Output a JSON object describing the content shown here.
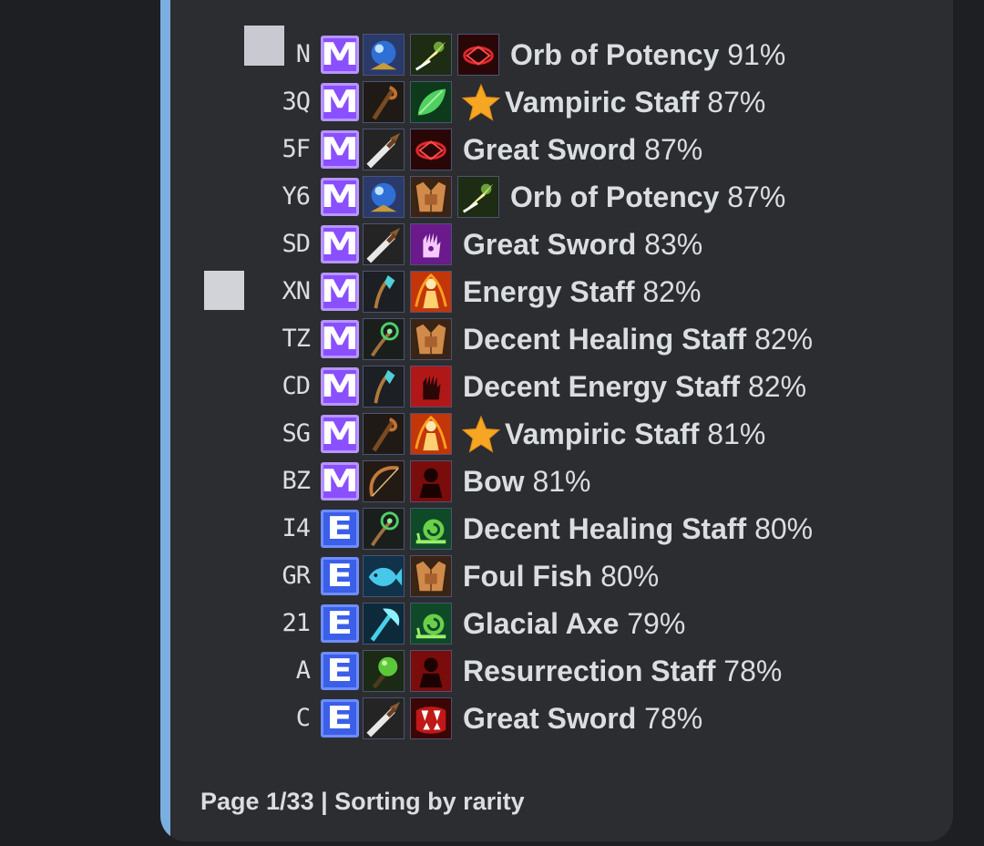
{
  "rows": [
    {
      "code": "N",
      "rarity": "M",
      "name": "Orb of Potency",
      "percent": "91%",
      "star": false,
      "icons": [
        "orb-icon",
        "dart-icon",
        "red-rune-icon"
      ]
    },
    {
      "code": "3Q",
      "rarity": "M",
      "name": "Vampiric Staff",
      "percent": "87%",
      "star": true,
      "icons": [
        "staff-icon",
        "leaf-icon"
      ]
    },
    {
      "code": "5F",
      "rarity": "M",
      "name": "Great Sword",
      "percent": "87%",
      "star": false,
      "icons": [
        "sword-icon",
        "red-rune-icon"
      ]
    },
    {
      "code": "Y6",
      "rarity": "M",
      "name": "Orb of Potency",
      "percent": "87%",
      "star": false,
      "icons": [
        "orb-icon",
        "torso-icon",
        "dart-icon"
      ]
    },
    {
      "code": "SD",
      "rarity": "M",
      "name": "Great Sword",
      "percent": "83%",
      "star": false,
      "icons": [
        "sword-icon",
        "purple-hand-icon"
      ]
    },
    {
      "code": "XN",
      "rarity": "M",
      "name": "Energy Staff",
      "percent": "82%",
      "star": false,
      "icons": [
        "crystal-staff-icon",
        "flame-figure-icon"
      ]
    },
    {
      "code": "TZ",
      "rarity": "M",
      "name": "Decent Healing Staff",
      "percent": "82%",
      "star": false,
      "icons": [
        "green-staff-icon",
        "torso-icon"
      ]
    },
    {
      "code": "CD",
      "rarity": "M",
      "name": "Decent Energy Staff",
      "percent": "82%",
      "star": false,
      "icons": [
        "crystal-staff-icon",
        "red-hand-icon"
      ]
    },
    {
      "code": "SG",
      "rarity": "M",
      "name": "Vampiric Staff",
      "percent": "81%",
      "star": true,
      "icons": [
        "staff-icon",
        "flame-figure-icon"
      ]
    },
    {
      "code": "BZ",
      "rarity": "M",
      "name": "Bow",
      "percent": "81%",
      "star": false,
      "icons": [
        "bow-icon",
        "dark-figure-icon"
      ]
    },
    {
      "code": "I4",
      "rarity": "E",
      "name": "Decent Healing Staff",
      "percent": "80%",
      "star": false,
      "icons": [
        "green-staff-icon",
        "snail-icon"
      ]
    },
    {
      "code": "GR",
      "rarity": "E",
      "name": "Foul Fish",
      "percent": "80%",
      "star": false,
      "icons": [
        "fish-icon",
        "torso-icon"
      ]
    },
    {
      "code": "21",
      "rarity": "E",
      "name": "Glacial Axe",
      "percent": "79%",
      "star": false,
      "icons": [
        "axe-icon",
        "snail-icon"
      ]
    },
    {
      "code": "A",
      "rarity": "E",
      "name": "Resurrection Staff",
      "percent": "78%",
      "star": false,
      "icons": [
        "green-orb-staff-icon",
        "dark-figure-icon"
      ]
    },
    {
      "code": "C",
      "rarity": "E",
      "name": "Great Sword",
      "percent": "78%",
      "star": false,
      "icons": [
        "sword-icon",
        "fangs-icon"
      ]
    }
  ],
  "footer": {
    "text": "Page 1/33 | Sorting by rarity"
  },
  "colors": {
    "accent_bar": "#7aaee0",
    "rarity_m": "#8a4fff",
    "rarity_e": "#3b5fe8",
    "star": "#f5a623"
  }
}
